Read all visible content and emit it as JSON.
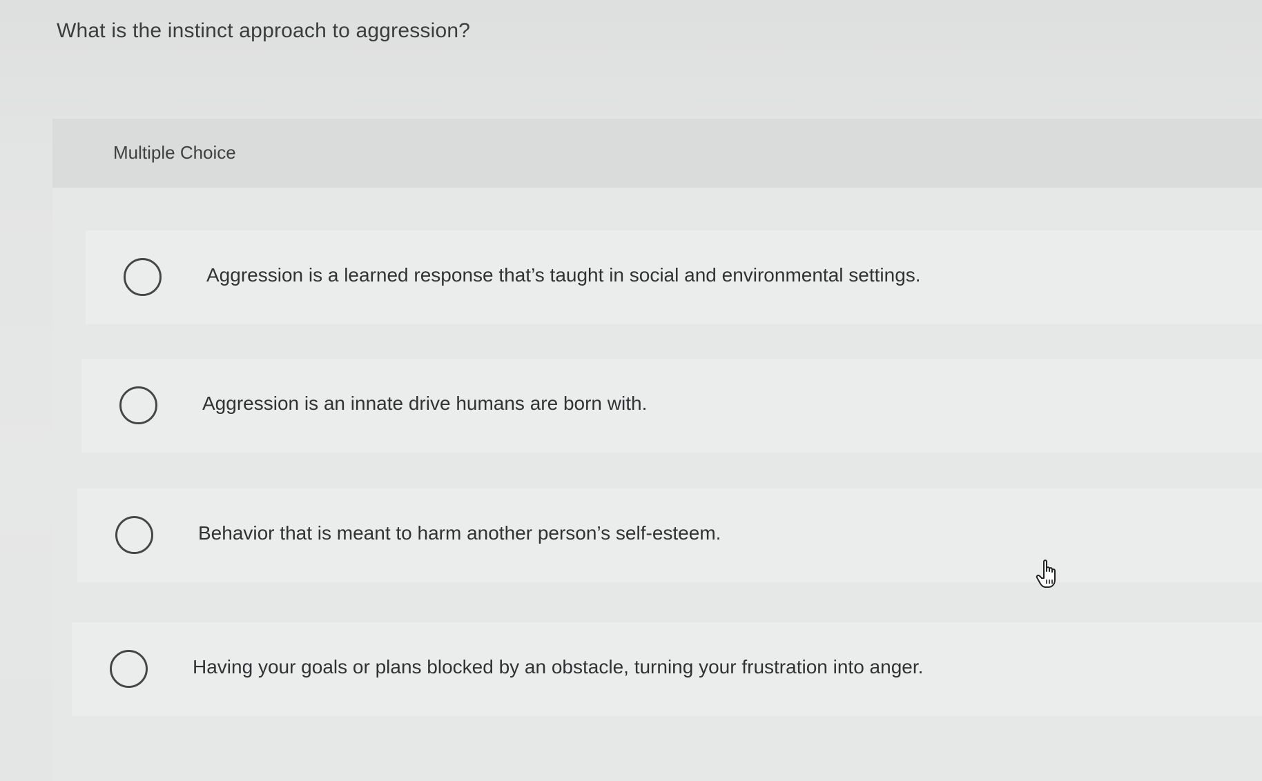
{
  "question": {
    "text": "What is the instinct approach to aggression?"
  },
  "multiple_choice": {
    "label": "Multiple Choice",
    "options": [
      {
        "text": "Aggression is a learned response that’s taught in social and environmental settings.",
        "selected": false
      },
      {
        "text": "Aggression is an innate drive humans are born with.",
        "selected": false
      },
      {
        "text": "Behavior that is meant to harm another person’s self-esteem.",
        "selected": false
      },
      {
        "text": "Having your goals or plans blocked by an obstacle, turning your frustration into anger.",
        "selected": false
      }
    ]
  },
  "cursor": {
    "icon": "hand-pointer-icon"
  },
  "colors": {
    "background": "#e3e4e4",
    "header_band": "#dadbdb",
    "option_card": "#ebecec",
    "text": "#303233",
    "radio_border": "#444648"
  }
}
